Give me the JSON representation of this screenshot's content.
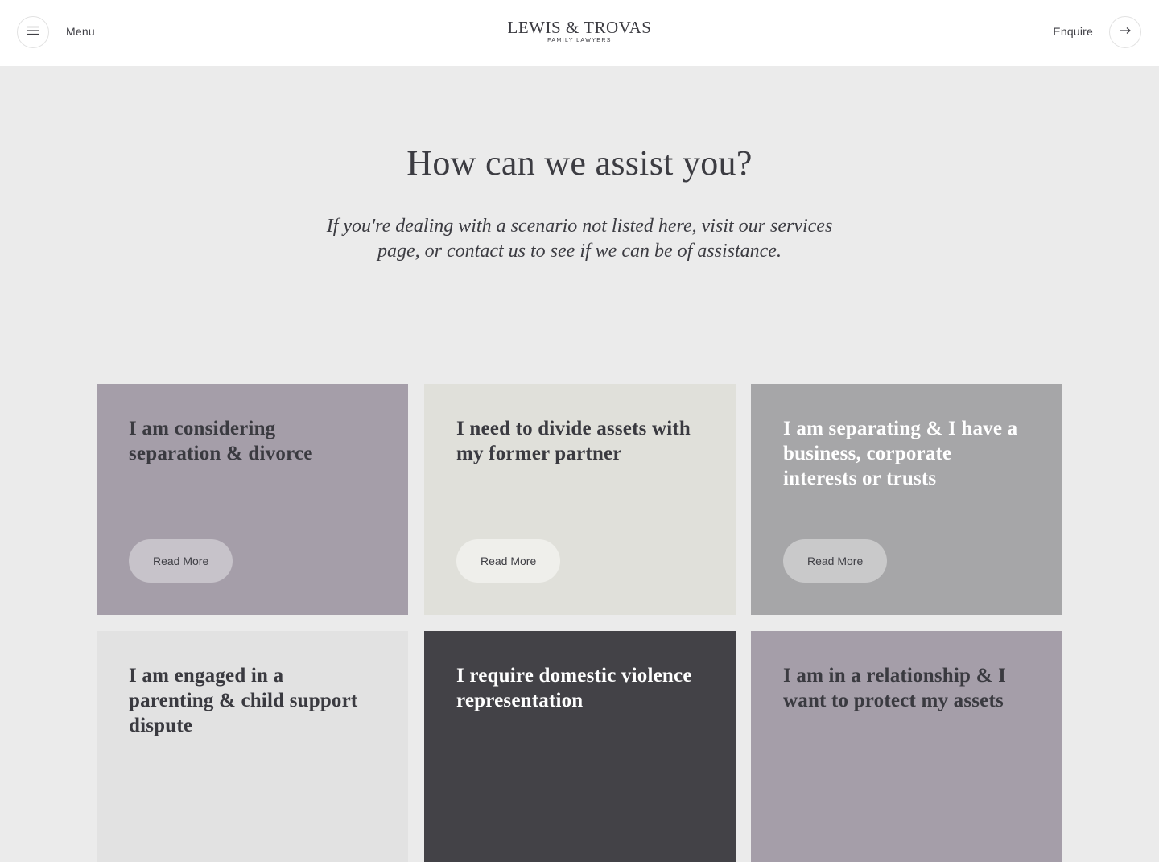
{
  "header": {
    "menu_label": "Menu",
    "enquire_label": "Enquire",
    "logo_main": "LEWIS & TROVAS",
    "logo_sub": "FAMILY LAWYERS",
    "menu_icon": "hamburger-icon",
    "enquire_icon": "arrow-right-icon"
  },
  "intro": {
    "title": "How can we assist you?",
    "text_before_link": "If you're dealing with a scenario not listed here, visit our ",
    "link_text": "services",
    "text_after_link": " page, or contact us to see if we can be of assistance."
  },
  "cards": [
    {
      "title": "I am considering separation & divorce",
      "button": "Read More",
      "bg": "#a59ea9"
    },
    {
      "title": "I need to divide assets with my former partner",
      "button": "Read More",
      "bg": "#e0e0da"
    },
    {
      "title": "I am separating & I have a business, corporate interests or trusts",
      "button": "Read More",
      "bg": "#a6a6a8"
    },
    {
      "title": "I am engaged in a parenting & child support dispute",
      "bg": "#e2e2e2"
    },
    {
      "title": "I require domestic violence representation",
      "bg": "#434247"
    },
    {
      "title": "I am in a relationship & I want to protect my assets",
      "bg": "#a59ea9"
    }
  ]
}
